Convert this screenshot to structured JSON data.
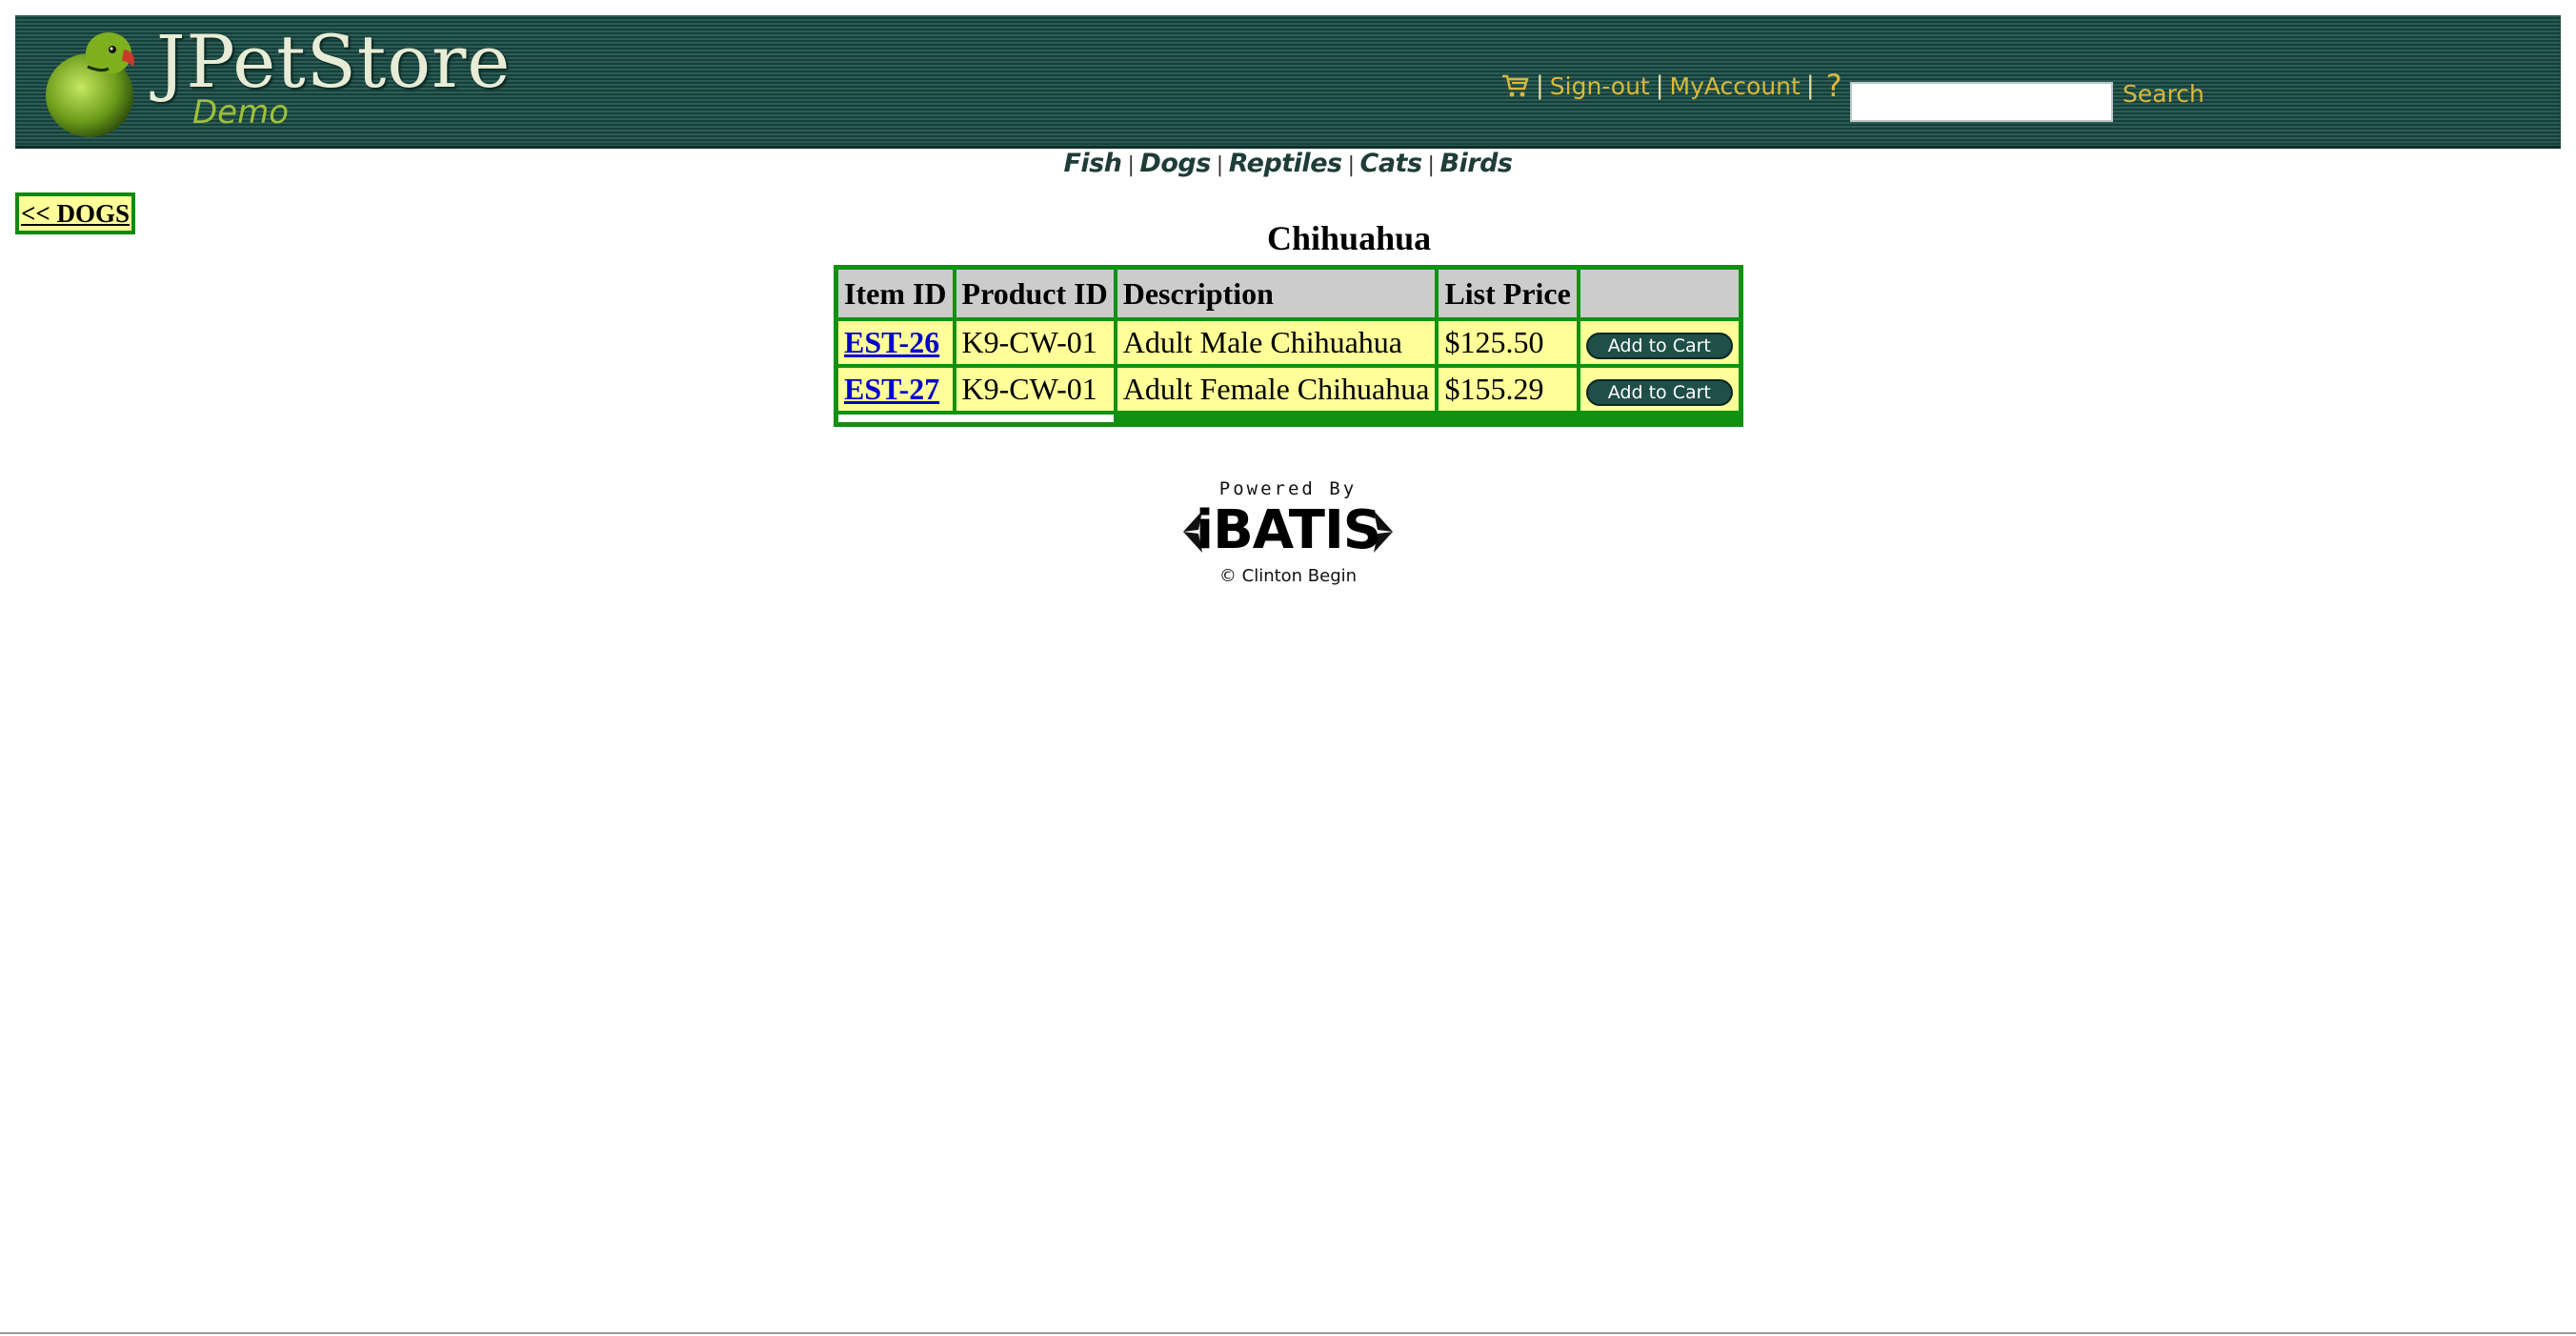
{
  "header": {
    "logo_title": "JPetStore",
    "logo_subtitle": "Demo",
    "nav": {
      "sign_out": "Sign-out",
      "my_account": "MyAccount",
      "help": "?",
      "separator": "|"
    },
    "search": {
      "value": "",
      "button_label": "Search"
    }
  },
  "categories": [
    {
      "label": "Fish"
    },
    {
      "label": "Dogs"
    },
    {
      "label": "Reptiles"
    },
    {
      "label": "Cats"
    },
    {
      "label": "Birds"
    }
  ],
  "category_separator": "|",
  "back_link": "<< DOGS",
  "product": {
    "title": "Chihuahua"
  },
  "table": {
    "headers": [
      "Item ID",
      "Product ID",
      "Description",
      "List Price",
      ""
    ],
    "rows": [
      {
        "item_id": "EST-26",
        "product_id": "K9-CW-01",
        "description": "Adult Male Chihuahua",
        "price": "$125.50",
        "action": "Add to Cart"
      },
      {
        "item_id": "EST-27",
        "product_id": "K9-CW-01",
        "description": "Adult Female Chihuahua",
        "price": "$155.29",
        "action": "Add to Cart"
      }
    ]
  },
  "footer": {
    "powered_by": "Powered By",
    "brand": "iBATIS",
    "copyright": "© Clinton Begin"
  },
  "icons": {
    "cart": "cart-icon",
    "help": "help-icon",
    "logo": "parrot-logo-icon"
  },
  "colors": {
    "header_bg": "#1b4a44",
    "nav_text": "#d9b83a",
    "table_border": "#119111",
    "cell_bg": "#ffff99",
    "header_cell_bg": "#cccccc",
    "link": "#0000cc"
  }
}
